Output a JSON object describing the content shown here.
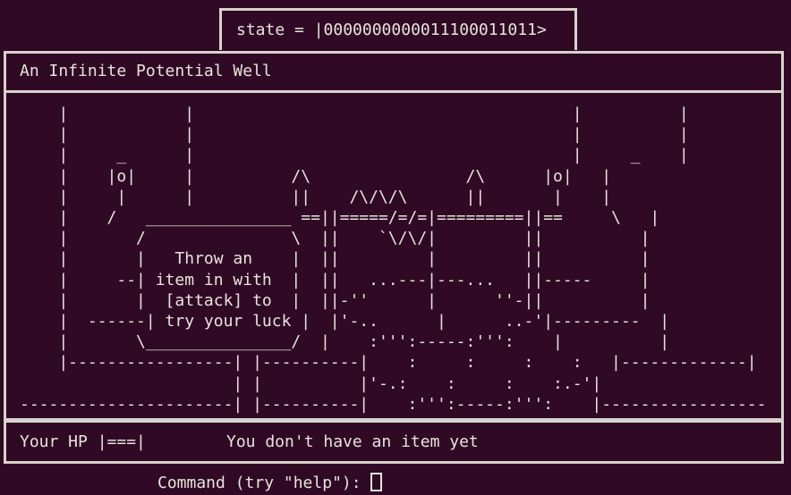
{
  "state_label": "state = |000000000001110001101 1>",
  "title": "An Infinite Potential Well",
  "scene_art": [
    "    |            |                                       |          |",
    "    |            |                                       |          |",
    "    |     _      |                                       |     _    |",
    "    |    |o|     |          /\\                /\\      |o|   |",
    "    |     |      |          ||    /\\/\\/\\      ||       |    |",
    "    |    /   _______________ ==||=====/=/=|=========||==     \\   |",
    "    |       /               \\  ||    `\\/\\/|         ||          |",
    "    |       |   Throw an    |  ||         |         ||          |",
    "    |     --| item in with  |  ||   ...---|---...   ||-----     |",
    "    |       |  [attack] to  |  ||-''      |      ''-||          |",
    "    |  ------| try your luck |  |'-..      |      ..-'|---------  |",
    "    |       \\_______________/  |    :''':-----:''':    |          |",
    "    |-----------------| |----------|    :     :     :    :   |-------------|",
    "                      | |          |'-.:    :     :    :.-'|",
    "----------------------| |----------|    :''':-----:''':    |-----------------"
  ],
  "status": {
    "hp_label": "Your HP |===|",
    "item_message": "You don't have an item yet"
  },
  "command": {
    "prompt": "Command (try \"help\"):",
    "value": ""
  }
}
